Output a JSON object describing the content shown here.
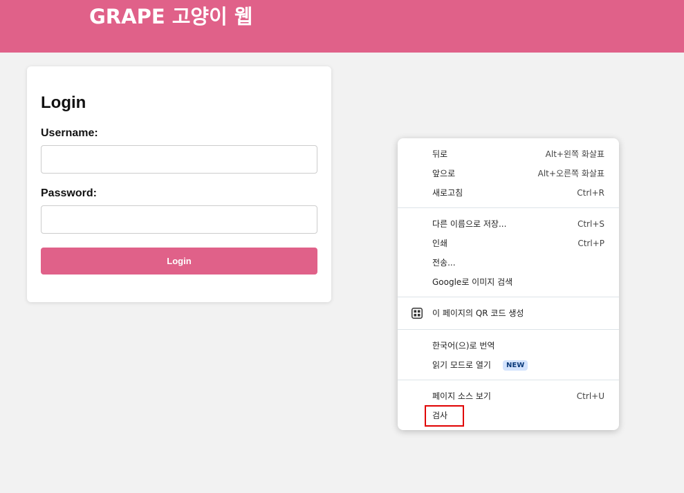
{
  "header": {
    "title": "GRAPE 고양이 웹",
    "background_color": "#e06189"
  },
  "login": {
    "heading": "Login",
    "username_label": "Username:",
    "username_value": "",
    "password_label": "Password:",
    "password_value": "",
    "button_label": "Login",
    "accent_color": "#e06189"
  },
  "context_menu": {
    "back": {
      "label": "뒤로",
      "shortcut": "Alt+왼쪽 화살표"
    },
    "forward": {
      "label": "앞으로",
      "shortcut": "Alt+오른쪽 화살표"
    },
    "reload": {
      "label": "새로고침",
      "shortcut": "Ctrl+R"
    },
    "save_as": {
      "label": "다른 이름으로 저장...",
      "shortcut": "Ctrl+S"
    },
    "print": {
      "label": "인쇄",
      "shortcut": "Ctrl+P"
    },
    "cast": {
      "label": "전송..."
    },
    "google_image_search": {
      "label": "Google로 이미지 검색"
    },
    "qr_code": {
      "label": "이 페이지의 QR 코드 생성",
      "icon": "qr-code-icon"
    },
    "translate": {
      "label": "한국어(으)로 번역"
    },
    "reading_mode": {
      "label": "읽기 모드로 열기",
      "badge": "NEW"
    },
    "view_source": {
      "label": "페이지 소스 보기",
      "shortcut": "Ctrl+U"
    },
    "inspect": {
      "label": "검사"
    }
  },
  "annotation": {
    "highlight_color": "#e00000"
  }
}
